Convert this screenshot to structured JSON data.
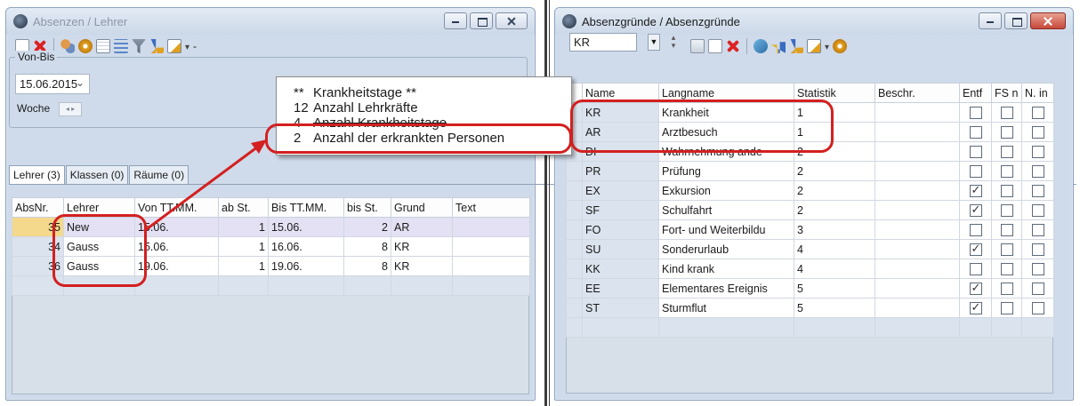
{
  "left_window": {
    "title": "Absenzen / Lehrer",
    "date_group": {
      "legend": "Von-Bis",
      "date_value": "15.06.2015",
      "woche_label": "Woche",
      "woche_spin": "◂ ▸"
    },
    "tabs": [
      "Lehrer (3)",
      "Klassen (0)",
      "Räume (0)"
    ],
    "toolbar_more": "-",
    "columns": [
      "AbsNr.",
      "Lehrer",
      "Von TT.MM.",
      "ab St.",
      "Bis TT.MM.",
      "bis St.",
      "Grund",
      "Text"
    ],
    "rows": [
      {
        "absnr": "35",
        "lehrer": "New",
        "von": "15.06.",
        "ab": "1",
        "bis": "15.06.",
        "bis_st": "2",
        "grund": "AR",
        "text": ""
      },
      {
        "absnr": "34",
        "lehrer": "Gauss",
        "von": "15.06.",
        "ab": "1",
        "bis": "16.06.",
        "bis_st": "8",
        "grund": "KR",
        "text": ""
      },
      {
        "absnr": "36",
        "lehrer": "Gauss",
        "von": "19.06.",
        "ab": "1",
        "bis": "19.06.",
        "bis_st": "8",
        "grund": "KR",
        "text": ""
      }
    ]
  },
  "popup": {
    "rows": [
      {
        "num": "**",
        "label": "Krankheitstage  **",
        "struck": false
      },
      {
        "num": "12",
        "label": "Anzahl Lehrkräfte",
        "struck": false
      },
      {
        "num": "4",
        "label": "Anzahl Krankheitstage",
        "struck": true
      },
      {
        "num": "2",
        "label": "Anzahl der erkrankten Personen",
        "struck": false
      }
    ]
  },
  "right_window": {
    "title": "Absenzgründe / Absenzgründe",
    "combo_value": "KR",
    "columns": [
      "Name",
      "Langname",
      "Statistik",
      "Beschr.",
      "Entf",
      "FS n",
      "N. in"
    ],
    "rows": [
      {
        "name": "KR",
        "langname": "Krankheit",
        "statistik": "1",
        "beschr": "",
        "entf": false,
        "fs": false,
        "nin": false
      },
      {
        "name": "AR",
        "langname": "Arztbesuch",
        "statistik": "1",
        "beschr": "",
        "entf": false,
        "fs": false,
        "nin": false
      },
      {
        "name": "DI",
        "langname": "Wahrnehmung ande",
        "statistik": "2",
        "beschr": "",
        "entf": false,
        "fs": false,
        "nin": false
      },
      {
        "name": "PR",
        "langname": "Prüfung",
        "statistik": "2",
        "beschr": "",
        "entf": false,
        "fs": false,
        "nin": false
      },
      {
        "name": "EX",
        "langname": "Exkursion",
        "statistik": "2",
        "beschr": "",
        "entf": true,
        "fs": false,
        "nin": false
      },
      {
        "name": "SF",
        "langname": "Schulfahrt",
        "statistik": "2",
        "beschr": "",
        "entf": true,
        "fs": false,
        "nin": false
      },
      {
        "name": "FO",
        "langname": "Fort- und Weiterbildu",
        "statistik": "3",
        "beschr": "",
        "entf": false,
        "fs": false,
        "nin": false
      },
      {
        "name": "SU",
        "langname": "Sonderurlaub",
        "statistik": "4",
        "beschr": "",
        "entf": true,
        "fs": false,
        "nin": false
      },
      {
        "name": "KK",
        "langname": "Kind krank",
        "statistik": "4",
        "beschr": "",
        "entf": false,
        "fs": false,
        "nin": false
      },
      {
        "name": "EE",
        "langname": "Elementares Ereignis",
        "statistik": "5",
        "beschr": "",
        "entf": true,
        "fs": false,
        "nin": false
      },
      {
        "name": "ST",
        "langname": "Sturmflut",
        "statistik": "5",
        "beschr": "",
        "entf": true,
        "fs": false,
        "nin": false
      }
    ]
  },
  "colors": {
    "annotation_red": "#d32020",
    "window_frame": "#cfdbea",
    "selected_row": "#e3e1f3",
    "selected_key": "#f4d88c"
  }
}
